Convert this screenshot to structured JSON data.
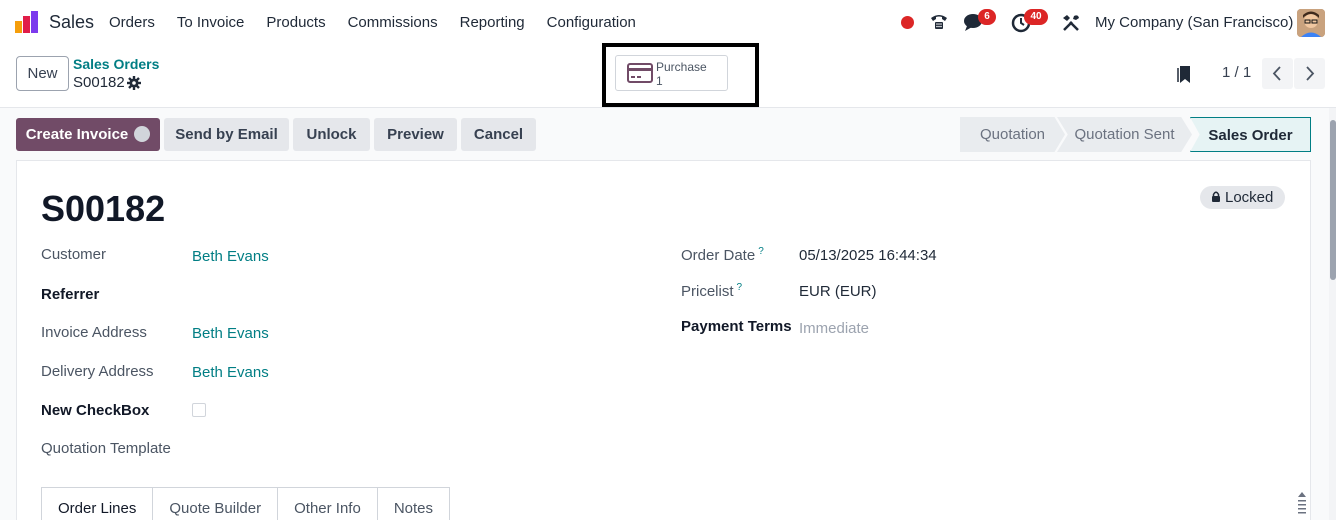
{
  "navbar": {
    "app_name": "Sales",
    "menu": [
      "Orders",
      "To Invoice",
      "Products",
      "Commissions",
      "Reporting",
      "Configuration"
    ],
    "chat_badge": "6",
    "activity_badge": "40",
    "company": "My Company (San Francisco)"
  },
  "control": {
    "new_label": "New",
    "breadcrumb_parent": "Sales Orders",
    "breadcrumb_current": "S00182",
    "smart_button": {
      "label": "Purchase",
      "value": "1"
    },
    "pager": "1 / 1"
  },
  "actions": {
    "create_invoice": "Create Invoice",
    "send_email": "Send by Email",
    "unlock": "Unlock",
    "preview": "Preview",
    "cancel": "Cancel"
  },
  "status": {
    "stages": [
      "Quotation",
      "Quotation Sent",
      "Sales Order"
    ],
    "current": "Sales Order"
  },
  "form": {
    "locked": "Locked",
    "title": "S00182",
    "left_fields": [
      {
        "label": "Customer",
        "value": "Beth Evans"
      },
      {
        "label": "Referrer",
        "value": ""
      },
      {
        "label": "Invoice Address",
        "value": "Beth Evans"
      },
      {
        "label": "Delivery Address",
        "value": "Beth Evans"
      },
      {
        "label": "New CheckBox",
        "value": ""
      },
      {
        "label": "Quotation Template",
        "value": ""
      }
    ],
    "right_fields": [
      {
        "label": "Order Date",
        "help": "?",
        "value": "05/13/2025 16:44:34"
      },
      {
        "label": "Pricelist",
        "help": "?",
        "value": "EUR (EUR)"
      },
      {
        "label": "Payment Terms",
        "value": "Immediate"
      }
    ],
    "tabs": [
      "Order Lines",
      "Quote Builder",
      "Other Info",
      "Notes"
    ]
  },
  "colors": {
    "brand": "#714b67",
    "link": "#017e84",
    "badge": "#dc2626"
  }
}
